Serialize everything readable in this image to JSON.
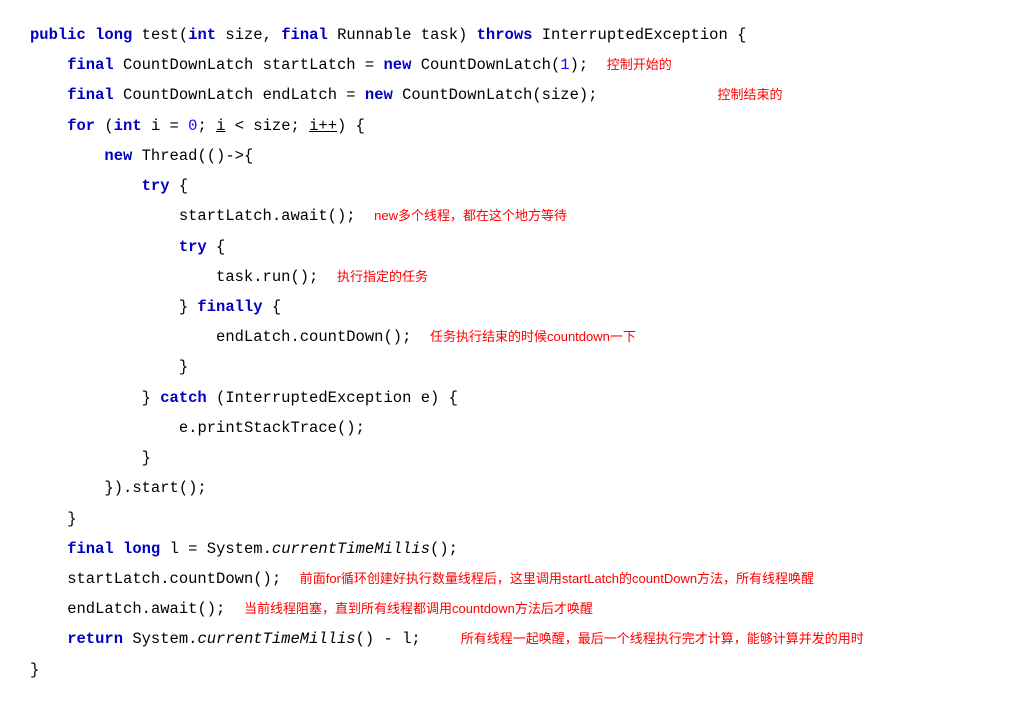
{
  "kw": {
    "public": "public",
    "long": "long",
    "int": "int",
    "final": "final",
    "throws": "throws",
    "new": "new",
    "for": "for",
    "try": "try",
    "catch": "catch",
    "finally": "finally",
    "return": "return"
  },
  "fn": {
    "test": "test",
    "size": "size",
    "Runnable": "Runnable",
    "task": "task",
    "InterruptedException": "InterruptedException",
    "CountDownLatch": "CountDownLatch",
    "startLatch": "startLatch",
    "endLatch": "endLatch",
    "Thread": "Thread",
    "await": "await",
    "run": "run",
    "countDown": "countDown",
    "printStackTrace": "printStackTrace",
    "start": "start",
    "System": "System",
    "currentTimeMillis": "currentTimeMillis",
    "i": "i",
    "ipp": "i++",
    "e": "e",
    "l": "l"
  },
  "num": {
    "one": "1",
    "zero": "0"
  },
  "cmt": {
    "c1": "控制开始的",
    "c2": "控制结束的",
    "c3": "new多个线程，都在这个地方等待",
    "c4": "执行指定的任务",
    "c5": "任务执行结束的时候countdown一下",
    "c6": "前面for循环创建好执行数量线程后，这里调用startLatch的countDown方法，所有线程唤醒",
    "c7": "当前线程阻塞，直到所有线程都调用countdown方法后才唤醒",
    "c8": "所有线程一起唤醒，最后一个线程执行完才计算，能够计算并发的用时"
  }
}
